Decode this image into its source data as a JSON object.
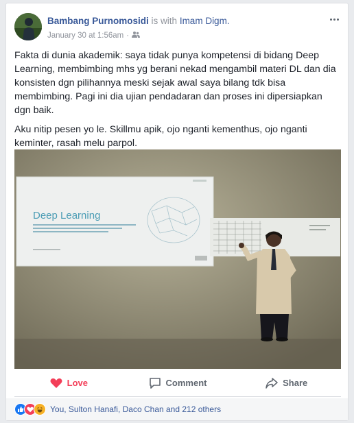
{
  "post": {
    "author": "Bambang Purnomosidi",
    "with_text": "is with",
    "tagged": "Imam Digm.",
    "timestamp": "January 30 at 1:56am",
    "audience_icon": "friends-icon",
    "paragraphs": [
      "Fakta di dunia akademik: saya tidak punya kompetensi di bidang Deep Learning, membimbing mhs yg berani nekad mengambil materi DL dan dia konsisten dgn pilihannya meski sejak awal saya bilang tdk bisa membimbing. Pagi ini dia ujian pendadaran dan proses ini dipersiapkan dgn baik.",
      "Aku nitip pesen yo le. Skillmu apik, ojo nganti kementhus, ojo nganti keminter, rasah melu parpol."
    ],
    "photo": {
      "slide_title": "Deep Learning"
    }
  },
  "actions": {
    "love": "Love",
    "comment": "Comment",
    "share": "Share"
  },
  "reactions": {
    "icons": [
      "like-icon",
      "love-icon",
      "haha-icon"
    ],
    "summary": "You, Sulton Hanafi, Daco Chan and 212 others"
  },
  "colors": {
    "link": "#385898",
    "love": "#f33e58",
    "like": "#1877f2",
    "muted": "#90949c"
  }
}
